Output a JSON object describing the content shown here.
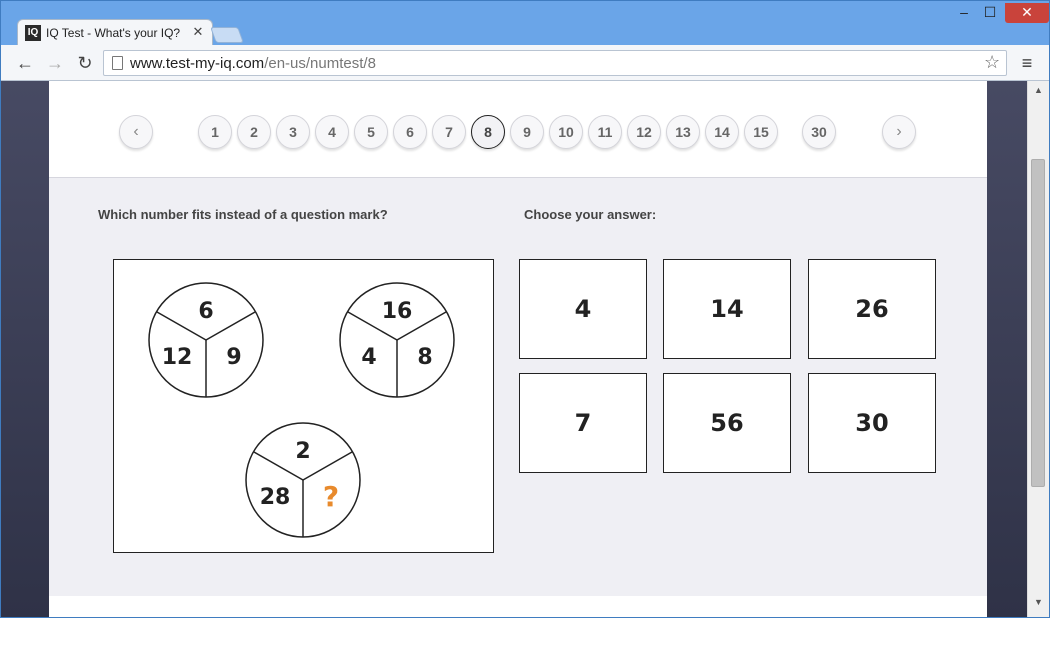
{
  "browser": {
    "tab_logo": "IQ",
    "tab_title": "IQ Test - What's your IQ?",
    "tab_close": "✕",
    "window_min": "‒",
    "window_max": "☐",
    "window_close": "✕",
    "back": "←",
    "forward": "→",
    "reload": "↻",
    "url_host": "www.test-my-iq.com",
    "url_path": "/en-us/numtest/8",
    "star": "☆",
    "menu": "≡"
  },
  "pager": {
    "prev": "‹",
    "next": "›",
    "pages": [
      "1",
      "2",
      "3",
      "4",
      "5",
      "6",
      "7",
      "8",
      "9",
      "10",
      "11",
      "12",
      "13",
      "14",
      "15"
    ],
    "last": "30",
    "active": "8"
  },
  "question": {
    "prompt": "Which number fits instead of a question mark?",
    "choose_label": "Choose your answer:",
    "circles": [
      {
        "top": "6",
        "left": "12",
        "right": "9"
      },
      {
        "top": "16",
        "left": "4",
        "right": "8"
      },
      {
        "top": "2",
        "left": "28",
        "right": "?"
      }
    ],
    "question_mark_color": "#e88a2c"
  },
  "answers": [
    "4",
    "14",
    "26",
    "7",
    "56",
    "30"
  ],
  "scrollbar": {
    "up": "▲",
    "down": "▼"
  }
}
